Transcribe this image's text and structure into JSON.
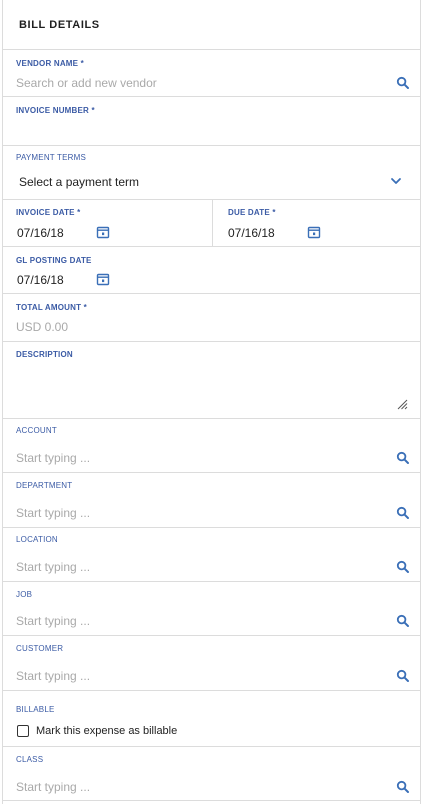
{
  "header": {
    "title": "BILL DETAILS"
  },
  "vendor": {
    "label": "VENDOR NAME *",
    "placeholder": "Search or add new vendor"
  },
  "invoice_number": {
    "label": "INVOICE NUMBER *",
    "value": ""
  },
  "payment_terms": {
    "label": "PAYMENT TERMS",
    "value": "Select a payment term"
  },
  "invoice_date": {
    "label": "INVOICE DATE *",
    "value": "07/16/18"
  },
  "due_date": {
    "label": "DUE DATE *",
    "value": "07/16/18"
  },
  "gl_posting_date": {
    "label": "GL POSTING DATE",
    "value": "07/16/18"
  },
  "total_amount": {
    "label": "TOTAL AMOUNT *",
    "placeholder": "USD 0.00"
  },
  "description": {
    "label": "DESCRIPTION",
    "value": ""
  },
  "account": {
    "label": "ACCOUNT",
    "placeholder": "Start typing ..."
  },
  "department": {
    "label": "DEPARTMENT",
    "placeholder": "Start typing ..."
  },
  "location": {
    "label": "LOCATION",
    "placeholder": "Start typing ..."
  },
  "job": {
    "label": "JOB",
    "placeholder": "Start typing ..."
  },
  "customer": {
    "label": "CUSTOMER",
    "placeholder": "Start typing ..."
  },
  "billable": {
    "label": "BILLABLE",
    "checkbox_label": "Mark this expense as billable",
    "checked": false
  },
  "class": {
    "label": "CLASS",
    "placeholder": "Start typing ..."
  },
  "colors": {
    "label_blue": "#3b5ba5",
    "icon_blue": "#3a6fb7",
    "divider": "#dcdcdc",
    "placeholder": "#a9a9a9"
  },
  "icons": {
    "search": "search-icon",
    "calendar": "calendar-icon",
    "chevron": "chevron-down-icon",
    "resize": "resize-handle-icon"
  }
}
